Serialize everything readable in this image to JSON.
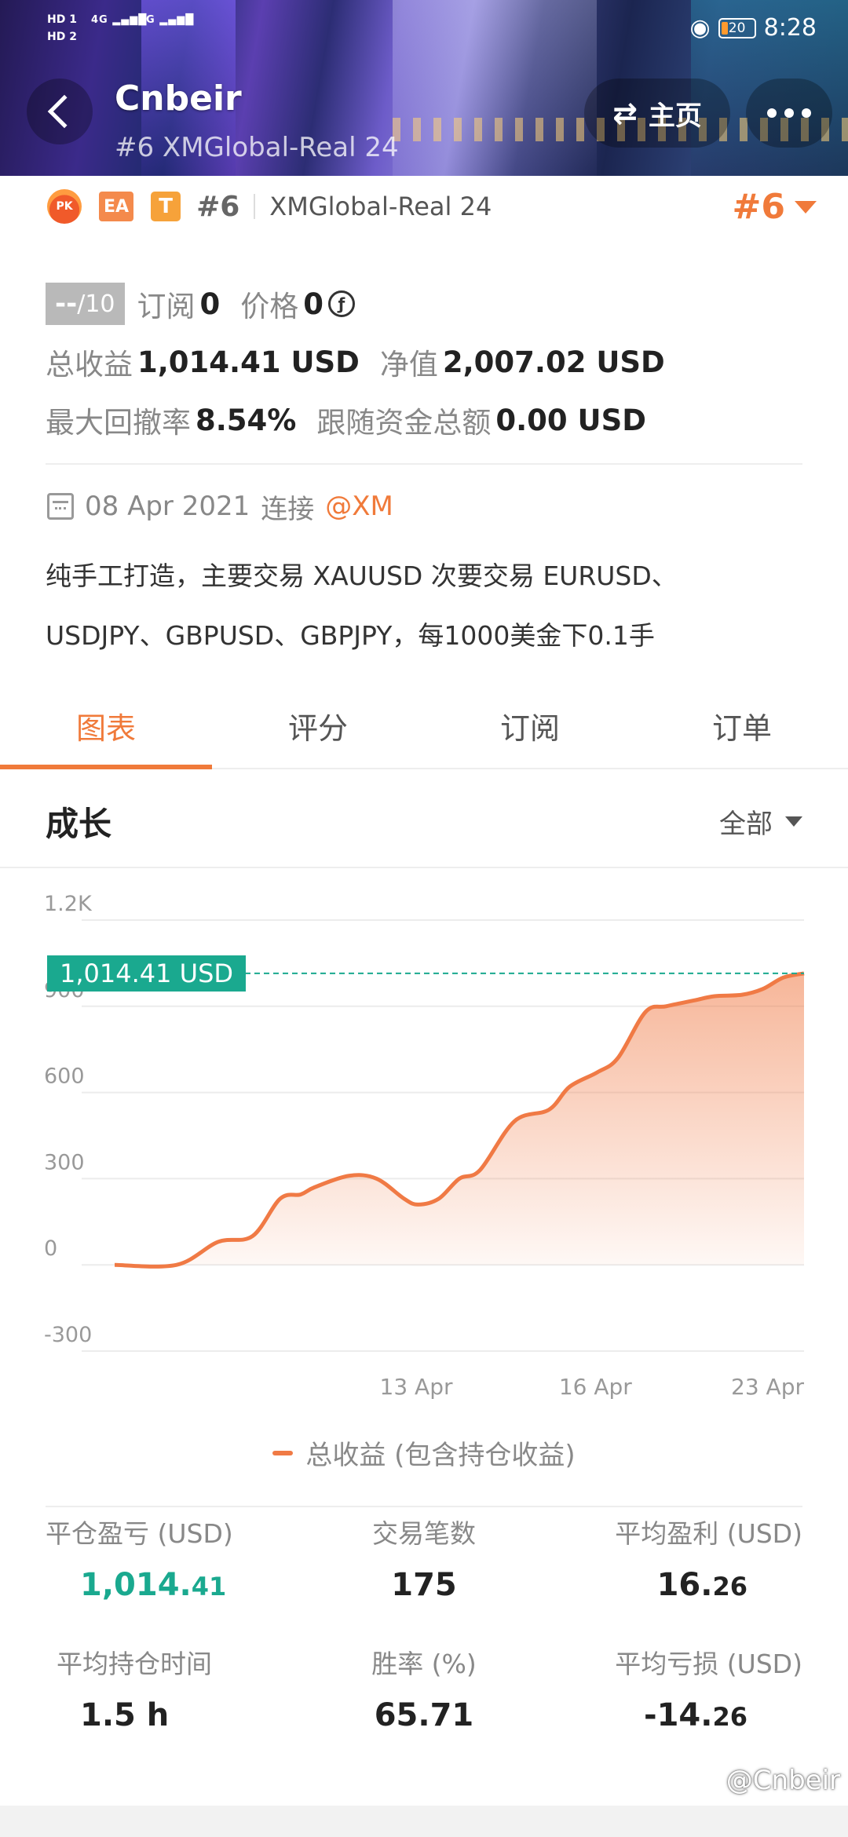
{
  "status_bar": {
    "hd1": "HD 1",
    "hd2": "HD 2",
    "signal1": "4G",
    "signal2": "4G",
    "battery": "20",
    "time": "8:28"
  },
  "header": {
    "title": "Cnbeir",
    "subtitle": "#6 XMGlobal-Real 24",
    "home_label": "主页"
  },
  "badges": {
    "pk": "PK",
    "ea": "EA",
    "t": "T",
    "rank": "#6",
    "server": "XMGlobal-Real 24",
    "rank_right": "#6"
  },
  "stats": {
    "score": "--",
    "score_max": "/10",
    "subscribe_label": "订阅",
    "subscribe_value": "0",
    "price_label": "价格",
    "price_value": "0",
    "total_profit_label": "总收益",
    "total_profit_value": "1,014.41 USD",
    "equity_label": "净值",
    "equity_value": "2,007.02 USD",
    "max_drawdown_label": "最大回撤率",
    "max_drawdown_value": "8.54%",
    "follow_funds_label": "跟随资金总额",
    "follow_funds_value": "0.00 USD"
  },
  "join": {
    "date": "08 Apr 2021",
    "connect_label": "连接",
    "broker": "@XM"
  },
  "description": {
    "line1": "纯手工打造，主要交易 XAUUSD 次要交易 EURUSD、",
    "line2": "USDJPY、GBPUSD、GBPJPY，每1000美金下0.1手"
  },
  "tabs": [
    {
      "label": "图表",
      "active": true
    },
    {
      "label": "评分",
      "active": false
    },
    {
      "label": "订阅",
      "active": false
    },
    {
      "label": "订单",
      "active": false
    }
  ],
  "section": {
    "title": "成长",
    "filter": "全部"
  },
  "chart_data": {
    "type": "area",
    "current_value_label": "1,014.41 USD",
    "y_ticks": [
      "1.2K",
      "900",
      "600",
      "300",
      "0",
      "-300"
    ],
    "ylim": [
      -300,
      1200
    ],
    "x_ticks": [
      "13 Apr",
      "16 Apr",
      "23 Apr"
    ],
    "series": [
      {
        "name": "总收益 (包含持仓收益)",
        "color": "#f07a45",
        "x": [
          0,
          0.09,
          0.15,
          0.2,
          0.24,
          0.27,
          0.29,
          0.34,
          0.38,
          0.42,
          0.44,
          0.47,
          0.5,
          0.53,
          0.58,
          0.63,
          0.66,
          0.7,
          0.73,
          0.77,
          0.8,
          0.84,
          0.87,
          0.91,
          0.94,
          0.97,
          1.0
        ],
        "values": [
          0,
          0,
          80,
          100,
          230,
          245,
          270,
          310,
          300,
          230,
          210,
          230,
          300,
          330,
          500,
          540,
          620,
          670,
          720,
          880,
          900,
          920,
          935,
          940,
          960,
          1000,
          1014.41
        ]
      }
    ],
    "legend": "总收益 (包含持仓收益)"
  },
  "metrics": [
    {
      "label": "平仓盈亏 (USD)",
      "value_main": "1,014.",
      "value_small": "41",
      "accent": "green"
    },
    {
      "label": "交易笔数",
      "value_main": "175",
      "value_small": "",
      "accent": "none"
    },
    {
      "label": "平均盈利 (USD)",
      "value_main": "16.",
      "value_small": "26",
      "accent": "none"
    },
    {
      "label": "平均持仓时间",
      "value_main": "1.5 h",
      "value_small": "",
      "accent": "none"
    },
    {
      "label": "胜率 (%)",
      "value_main": "65.71",
      "value_small": "",
      "accent": "none"
    },
    {
      "label": "平均亏损 (USD)",
      "value_main": "-14.",
      "value_small": "26",
      "accent": "none"
    }
  ],
  "watermark": "@Cnbeir"
}
